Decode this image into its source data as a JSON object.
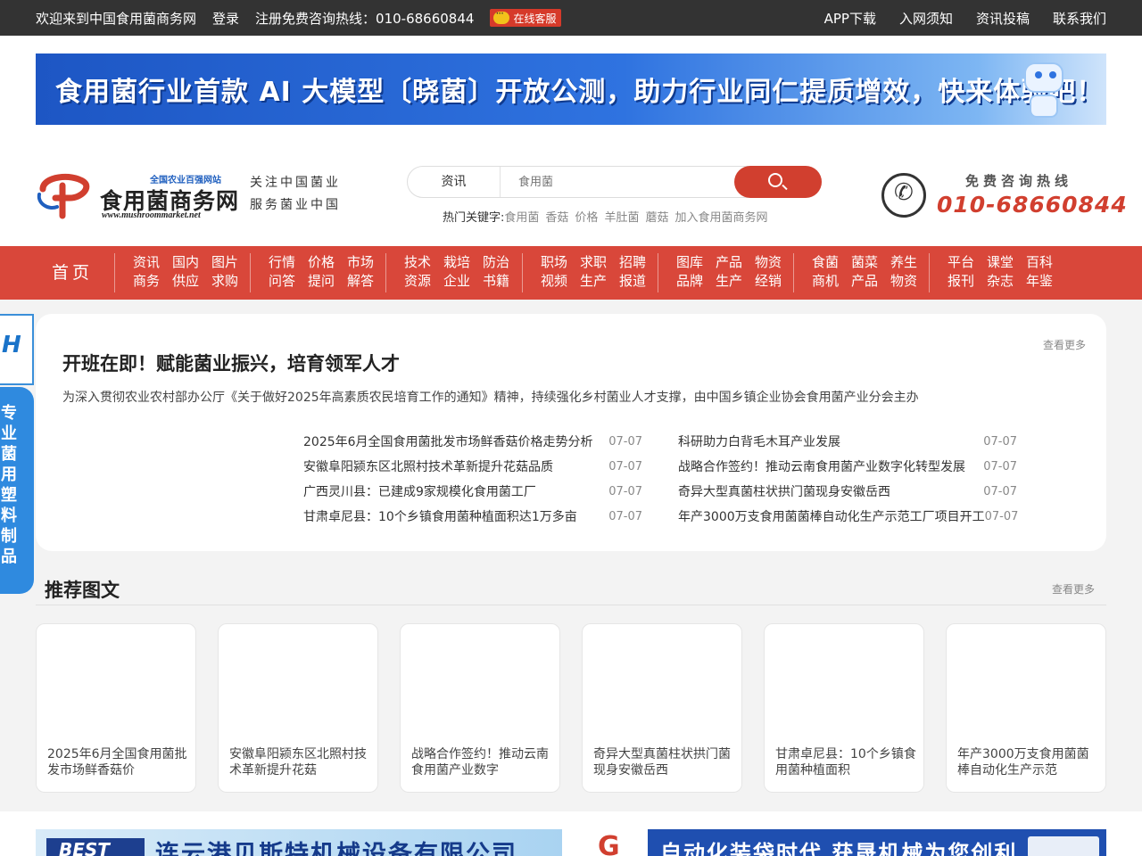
{
  "topbar": {
    "welcome": "欢迎来到中国食用菌商务网",
    "login": "登录",
    "register_hotline": "注册免费咨询热线：010-68660844",
    "online_service": "在线客服",
    "links": [
      "APP下载",
      "入网须知",
      "资讯投稿",
      "联系我们"
    ]
  },
  "banner": {
    "text": "食用菌行业首款 AI 大模型〔晓菌〕开放公测，助力行业同仁提质增效，快来体验吧！"
  },
  "logo": {
    "slogan_small": "全国农业百强网站",
    "name": "食用菌商务网",
    "url": "www.mushroommarket.net"
  },
  "tagline": [
    "关注中国菌业",
    "服务菌业中国"
  ],
  "search": {
    "category": "资讯",
    "placeholder": "食用菌",
    "hot_label": "热门关键字:",
    "hot_words": [
      "食用菌",
      "香菇",
      "价格",
      "羊肚菌",
      "蘑菇",
      "加入食用菌商务网"
    ]
  },
  "hotline": {
    "label": "免费咨询热线",
    "number": "010-68660844"
  },
  "nav": {
    "home": "首页",
    "groups": [
      [
        [
          "资讯",
          "国内",
          "图片"
        ],
        [
          "商务",
          "供应",
          "求购"
        ]
      ],
      [
        [
          "行情",
          "价格",
          "市场"
        ],
        [
          "问答",
          "提问",
          "解答"
        ]
      ],
      [
        [
          "技术",
          "栽培",
          "防治"
        ],
        [
          "资源",
          "企业",
          "书籍"
        ]
      ],
      [
        [
          "职场",
          "求职",
          "招聘"
        ],
        [
          "视频",
          "生产",
          "报道"
        ]
      ],
      [
        [
          "图库",
          "产品",
          "物资"
        ],
        [
          "品牌",
          "生产",
          "经销"
        ]
      ],
      [
        [
          "食菌",
          "菌菜",
          "养生"
        ],
        [
          "商机",
          "产品",
          "物资"
        ]
      ],
      [
        [
          "平台",
          "课堂",
          "百科"
        ],
        [
          "报刊",
          "杂志",
          "年鉴"
        ]
      ]
    ]
  },
  "side_float": {
    "vertical_text": [
      "专",
      "业",
      "菌",
      "用",
      "塑",
      "料",
      "制",
      "品"
    ]
  },
  "featured": {
    "more": "查看更多",
    "title": "开班在即！赋能菌业振兴，培育领军人才",
    "desc": "为深入贯彻农业农村部办公厅《关于做好2025年高素质农民培育工作的通知》精神，持续强化乡村菌业人才支撑，由中国乡镇企业协会食用菌产业分会主办",
    "col1": [
      {
        "title": "2025年6月全国食用菌批发市场鲜香菇价格走势分析",
        "date": "07-07"
      },
      {
        "title": "安徽阜阳颍东区北照村技术革新提升花菇品质",
        "date": "07-07"
      },
      {
        "title": "广西灵川县：已建成9家规模化食用菌工厂",
        "date": "07-07"
      },
      {
        "title": "甘肃卓尼县：10个乡镇食用菌种植面积达1万多亩",
        "date": "07-07"
      }
    ],
    "col2": [
      {
        "title": "科研助力白背毛木耳产业发展",
        "date": "07-07"
      },
      {
        "title": "战略合作签约！推动云南食用菌产业数字化转型发展",
        "date": "07-07"
      },
      {
        "title": "奇异大型真菌柱状拱门菌现身安徽岳西",
        "date": "07-07"
      },
      {
        "title": "年产3000万支食用菌菌棒自动化生产示范工厂项目开工",
        "date": "07-07"
      }
    ]
  },
  "recommend": {
    "title": "推荐图文",
    "more": "查看更多",
    "items": [
      "2025年6月全国食用菌批发市场鲜香菇价",
      "安徽阜阳颍东区北照村技术革新提升花菇",
      "战略合作签约！推动云南食用菌产业数字",
      "奇异大型真菌柱状拱门菌现身安徽岳西",
      "甘肃卓尼县：10个乡镇食用菌种植面积",
      "年产3000万支食用菌菌棒自动化生产示范"
    ]
  },
  "ads": {
    "ad1_logo": "BEST",
    "ad1_text": "连云港贝斯特机械设备有限公司",
    "ad2_text": "自动化装袋时代 获晟机械为您创利"
  },
  "colors": {
    "topbar_bg": "#333333",
    "nav_bg": "#d9473a",
    "accent_red": "#d13f2f",
    "side_blue": "#2f8adf"
  }
}
